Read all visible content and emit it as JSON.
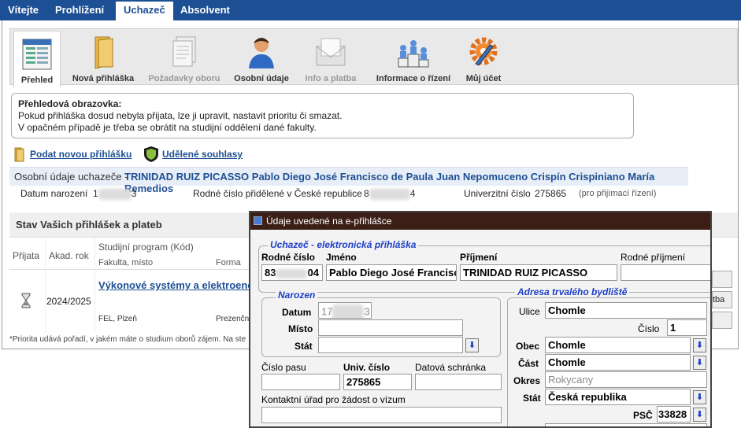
{
  "nav": {
    "tabs": [
      "Vítejte",
      "Prohlížení",
      "Uchazeč",
      "Absolvent"
    ],
    "active": "Uchazeč"
  },
  "toolbar": {
    "items": [
      {
        "label": "Přehled",
        "icon": "overview-icon"
      },
      {
        "label": "Nová přihláška",
        "icon": "folder-icon"
      },
      {
        "label": "Požadavky oboru",
        "icon": "documents-icon"
      },
      {
        "label": "Osobní údaje",
        "icon": "person-icon"
      },
      {
        "label": "Info a platba",
        "icon": "envelope-icon"
      },
      {
        "label": "Informace o řízení",
        "icon": "podium-icon"
      },
      {
        "label": "Můj účet",
        "icon": "gear-wrench-icon"
      }
    ]
  },
  "infobox": {
    "title": "Přehledová obrazovka:",
    "line1": "Pokud přihláška dosud nebyla přijata, lze ji upravit, nastavit prioritu či smazat.",
    "line2": "V opačném případě je třeba se obrátit na studijní oddělení dané fakulty."
  },
  "links": {
    "podat": "Podat novou přihlášku",
    "souhlasy": "Udělené souhlasy"
  },
  "osobni": {
    "label": "Osobní údaje uchazeče -",
    "name": "TRINIDAD RUIZ PICASSO Pablo Diego José Francisco de Paula Juan Nepomuceno Crispín Crispiniano María Remedios",
    "datum_label": "Datum narození",
    "datum_visible": "1",
    "datum_end": "3",
    "rodne_label": "Rodné číslo přidělené v České republice",
    "rodne_visible": "8",
    "rodne_end": "4",
    "univ_label": "Univerzitní číslo",
    "univ_value": "275865",
    "univ_note": "(pro přijímací řízení)"
  },
  "stav": {
    "title": "Stav Vašich přihlášek a plateb",
    "headers": {
      "prijata": "Přijata",
      "rok": "Akad. rok",
      "program": "Studijní program (Kód)",
      "fakulta": "Fakulta, místo",
      "forma": "Forma"
    },
    "row": {
      "rok": "2024/2025",
      "program": "Výkonové systémy a elektroene",
      "fakulta": "FEL, Plzeň",
      "forma": "Prezenční"
    },
    "footnote": "*Priorita udává pořadí, v jakém máte o studium oborů zájem. Na ste",
    "side_button": "tba"
  },
  "dialog": {
    "title": "Údaje uvedené na e-přihlášce",
    "section_main": "Uchazeč - elektronická přihláška",
    "labels": {
      "rodne": "Rodné číslo",
      "jmeno": "Jméno",
      "prijmeni": "Příjmení",
      "rodne_prijmeni": "Rodné příjmení"
    },
    "values": {
      "rodne_start": "83",
      "rodne_end": "04",
      "jmeno": "Pablo Diego José Francisco",
      "prijmeni": "TRINIDAD RUIZ PICASSO",
      "rodne_prijmeni": ""
    },
    "narozen": {
      "legend": "Narozen",
      "datum_label": "Datum",
      "datum_start": "17",
      "datum_end": "3",
      "misto_label": "Místo",
      "misto": "",
      "stat_label": "Stát",
      "stat": ""
    },
    "pas_label": "Číslo pasu",
    "pas": "",
    "univ_label": "Univ. číslo",
    "univ": "275865",
    "datova_label": "Datová schránka",
    "datova": "",
    "kontakt_label": "Kontaktní úřad pro žádost o vízum",
    "kontakt": "",
    "adresa": {
      "legend": "Adresa trvalého bydliště",
      "ulice_label": "Ulice",
      "ulice": "Chomle",
      "cislo_label": "Číslo",
      "cislo": "1",
      "obec_label": "Obec",
      "obec": "Chomle",
      "cast_label": "Část",
      "cast": "Chomle",
      "okres_label": "Okres",
      "okres": "Rokycany",
      "stat_label": "Stát",
      "stat": "Česká republika",
      "psc_label": "PSČ",
      "psc": "33828"
    },
    "dropdown_glyph": "⬇"
  }
}
